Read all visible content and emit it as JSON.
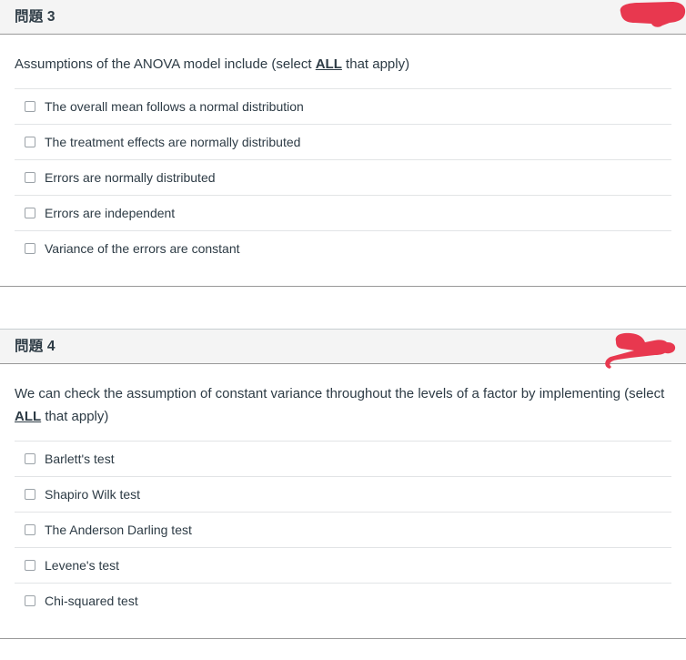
{
  "page": {
    "background_color": "#ffffff",
    "text_color": "#2d3b45",
    "header_background": "#f4f4f4",
    "redaction_color": "#e8384f",
    "separator_color": "#e2e4e6"
  },
  "questions": [
    {
      "header_label": "問題 3",
      "points_redacted": true,
      "redaction_icon": "red-scribble-mark",
      "prompt_before": "Assumptions of the ANOVA model include (select ",
      "prompt_emphasis": "ALL",
      "prompt_after": " that apply)",
      "options": [
        {
          "label": "The overall mean follows a normal distribution",
          "checked": false
        },
        {
          "label": "The treatment effects are normally distributed",
          "checked": false
        },
        {
          "label": "Errors are normally distributed",
          "checked": false
        },
        {
          "label": "Errors are independent",
          "checked": false
        },
        {
          "label": "Variance of the errors are constant",
          "checked": false
        }
      ]
    },
    {
      "header_label": "問題 4",
      "points_redacted": true,
      "redaction_icon": "red-scribble-mark",
      "prompt_before": "We can check the assumption of constant variance throughout the levels of a factor by implementing (select ",
      "prompt_emphasis": "ALL",
      "prompt_after": " that apply)",
      "options": [
        {
          "label": "Barlett's test",
          "checked": false
        },
        {
          "label": "Shapiro Wilk test",
          "checked": false
        },
        {
          "label": "The Anderson Darling test",
          "checked": false
        },
        {
          "label": "Levene's test",
          "checked": false
        },
        {
          "label": "Chi-squared test",
          "checked": false
        }
      ]
    }
  ]
}
